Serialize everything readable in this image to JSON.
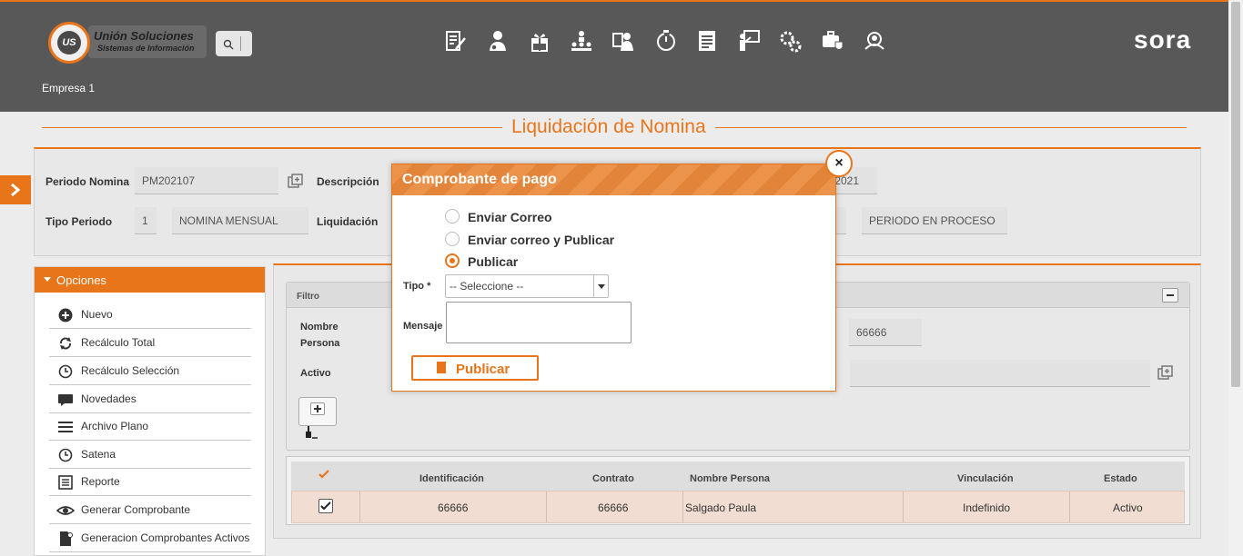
{
  "header": {
    "logo_title": "Unión Soluciones",
    "logo_sub": "Sistemas de Información",
    "logo_mark": "US",
    "brand": "sora",
    "company": "Empresa 1",
    "nav_icons": [
      "payroll-edit-icon",
      "employee-icon",
      "benefits-gift-icon",
      "org-structure-icon",
      "hr-admin-icon",
      "timer-icon",
      "document-list-icon",
      "training-icon",
      "settings-gears-icon",
      "health-security-icon",
      "users-search-icon"
    ]
  },
  "page": {
    "title": "Liquidación de Nomina"
  },
  "period_form": {
    "periodo_label": "Periodo Nomina",
    "periodo_value": "PM202107",
    "descripcion_label": "Descripción",
    "descripcion_value": "/2021",
    "tipo_periodo_label": "Tipo Periodo",
    "tipo_periodo_code": "1",
    "tipo_periodo_name": "NOMINA MENSUAL",
    "liquidacion_label": "Liquidación",
    "estado_value": "PERIODO EN PROCESO"
  },
  "options": {
    "title": "Opciones",
    "items": [
      {
        "label": "Nuevo",
        "icon": "plus-circle-icon"
      },
      {
        "label": "Recálculo Total",
        "icon": "refresh-icon"
      },
      {
        "label": "Recálculo Selección",
        "icon": "clock-icon"
      },
      {
        "label": "Novedades",
        "icon": "comment-icon"
      },
      {
        "label": "Archivo Plano",
        "icon": "lines-icon"
      },
      {
        "label": "Satena",
        "icon": "clock-icon"
      },
      {
        "label": "Reporte",
        "icon": "report-icon"
      },
      {
        "label": "Generar Comprobante",
        "icon": "eye-icon"
      },
      {
        "label": "Generacion Comprobantes Activos",
        "icon": "file-icon"
      }
    ]
  },
  "filter": {
    "title": "Filtro",
    "nombre_label": "Nombre Persona",
    "activo_label": "Activo",
    "id_value": "66666"
  },
  "grid": {
    "columns": [
      "Identificación",
      "Contrato",
      "Nombre Persona",
      "Vinculación",
      "Estado"
    ],
    "rows": [
      {
        "identificacion": "66666",
        "contrato": "66666",
        "nombre": "Salgado Paula",
        "vinculacion": "Indefinido",
        "estado": "Activo"
      }
    ]
  },
  "modal": {
    "title": "Comprobante de pago",
    "close": "×",
    "radios": [
      {
        "label": "Enviar Correo",
        "checked": false
      },
      {
        "label": "Enviar correo y Publicar",
        "checked": false
      },
      {
        "label": "Publicar",
        "checked": true
      }
    ],
    "tipo_label": "Tipo *",
    "tipo_value": "-- Seleccione --",
    "mensaje_label": "Mensaje",
    "publish_label": "Publicar"
  },
  "colors": {
    "accent": "#e8751a",
    "topbar": "#585858"
  }
}
